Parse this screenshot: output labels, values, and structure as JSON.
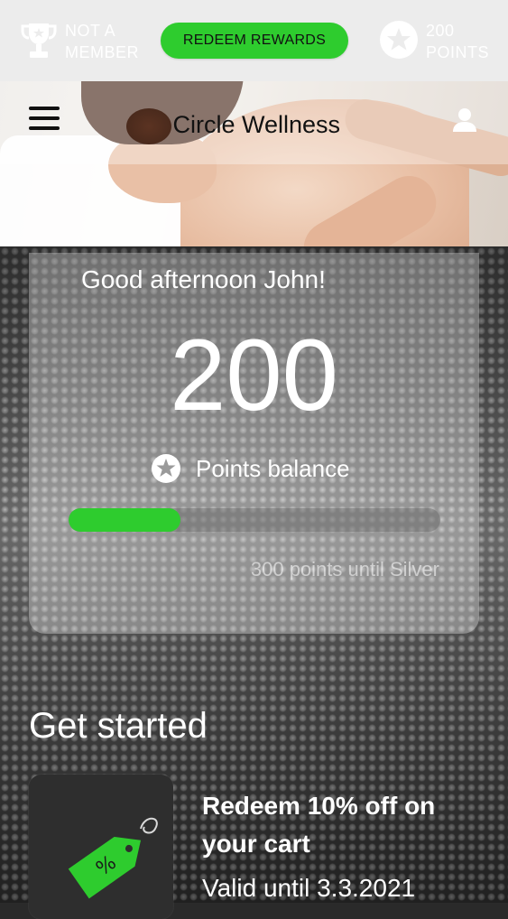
{
  "topbar": {
    "membership_line1": "NOT A",
    "membership_line2": "MEMBER",
    "redeem_label": "REDEEM REWARDS",
    "points_line1": "200",
    "points_line2": "POINTS",
    "icons": [
      "trophy-icon",
      "star-badge-icon"
    ]
  },
  "header": {
    "brand": "er Circle Wellness",
    "icons": [
      "hamburger-menu-icon",
      "user-icon"
    ]
  },
  "card": {
    "greeting": "Good afternoon John!",
    "points": "200",
    "balance_label": "Points balance",
    "progress_fraction": 0.3,
    "progress_caption": "300 points until Silver"
  },
  "get_started": {
    "title": "Get started",
    "offer": {
      "title": "Redeem 10% off on your cart",
      "valid": "Valid until 3.3.2021",
      "icon": "price-tag-icon"
    }
  },
  "colors": {
    "accent_green": "#2ecc2e",
    "topbar_bg": "#ececec"
  }
}
